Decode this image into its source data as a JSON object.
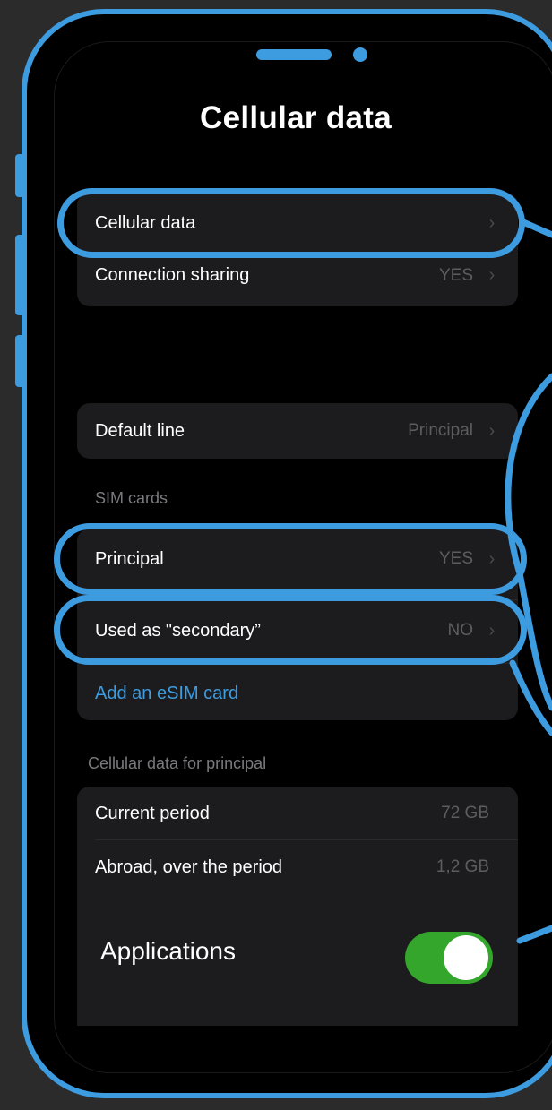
{
  "screen": {
    "title": "Cellular data"
  },
  "top_group": {
    "items": [
      {
        "label": "Cellular data",
        "value": "",
        "chevron": "›"
      },
      {
        "label": "Connection sharing",
        "value": "YES",
        "chevron": "›"
      }
    ]
  },
  "default_line": {
    "label": "Default line",
    "value": "Principal",
    "chevron": "›"
  },
  "sim_section": {
    "header": "SIM cards",
    "items": [
      {
        "label": "Principal",
        "value": "YES",
        "chevron": "›"
      },
      {
        "label": "Used as \"secondary”",
        "value": "NO",
        "chevron": "›"
      }
    ],
    "add_esim": "Add an eSIM card"
  },
  "usage_section": {
    "header": "Cellular data for principal",
    "items": [
      {
        "label": "Current period",
        "value": "72 GB"
      },
      {
        "label": "Abroad, over the period",
        "value": "1,2 GB"
      }
    ]
  },
  "applications": {
    "label": "Applications",
    "toggle_on": true
  },
  "colors": {
    "accent": "#3d9be0",
    "toggle_on": "#34a62c",
    "background": "#000000",
    "card": "#1c1c1e",
    "page": "#2b2b2b"
  },
  "icons": {
    "chevron": "chevron-right-icon",
    "speaker": "speaker-icon",
    "camera": "camera-icon"
  }
}
